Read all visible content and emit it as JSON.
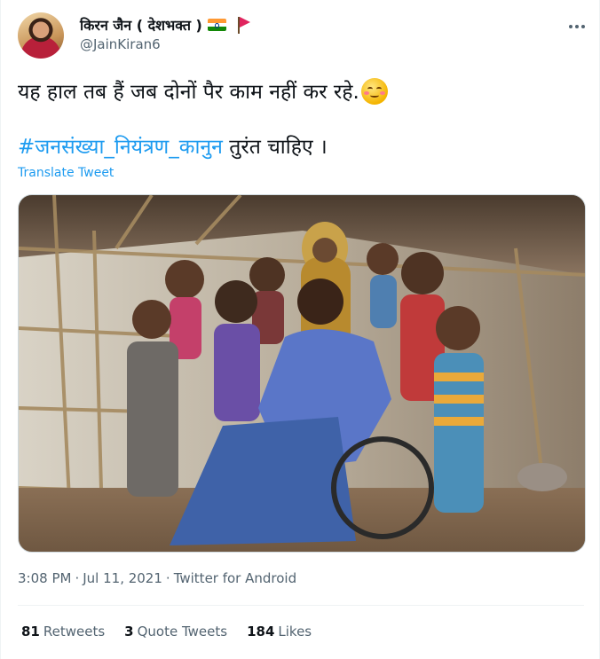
{
  "author": {
    "display_name": "किरन जैन ( देशभक्त )",
    "handle": "@JainKiran6",
    "avatar_icon": "profile-avatar",
    "badges": [
      "india-flag-icon",
      "saffron-pennant-icon"
    ]
  },
  "tweet": {
    "line1": "यह हाल तब हैं जब दोनों पैर काम नहीं कर रहे.",
    "line1_emoji": "smiling-face-with-smiling-eyes-emoji",
    "hashtag": "#जनसंख्या_नियंत्रण_कानुन",
    "line2_rest": " तुरंत चाहिए ।",
    "translate_label": "Translate Tweet",
    "media_description_icon": "photo-image"
  },
  "meta": {
    "time": "3:08 PM",
    "separator": "·",
    "date": "Jul 11, 2021",
    "source": "Twitter for Android"
  },
  "stats": {
    "retweets_count": "81",
    "retweets_label": "Retweets",
    "quotes_count": "3",
    "quotes_label": "Quote Tweets",
    "likes_count": "184",
    "likes_label": "Likes"
  },
  "colors": {
    "link": "#1d9bf0",
    "text": "#0f1419",
    "secondary": "#536471",
    "border": "#eff3f4"
  }
}
